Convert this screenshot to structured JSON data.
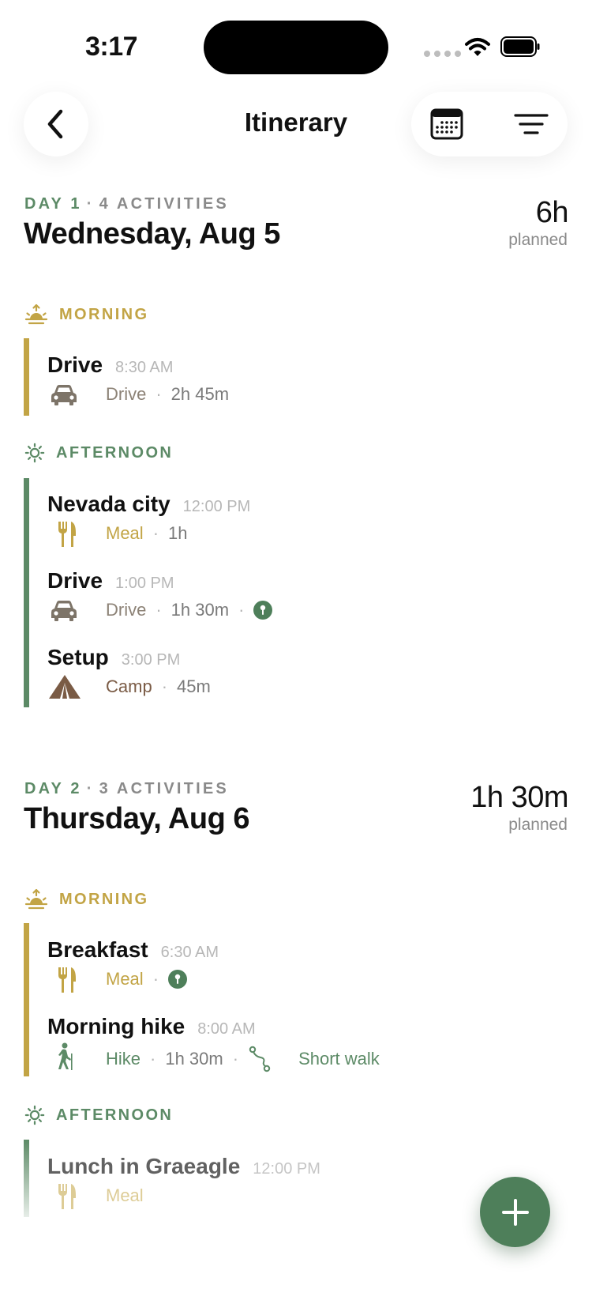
{
  "status": {
    "time": "3:17"
  },
  "header": {
    "title": "Itinerary"
  },
  "colors": {
    "morning": "#c2a445",
    "afternoon": "#5c8a66",
    "fab": "#4e7f5a"
  },
  "days": [
    {
      "day_label": "DAY 1",
      "count_label": "4 ACTIVITIES",
      "title": "Wednesday, Aug 5",
      "total": "6h",
      "total_label": "planned",
      "periods": [
        {
          "label": "MORNING",
          "icon": "sunrise-icon",
          "activities": [
            {
              "name": "Drive",
              "time": "8:30 AM",
              "icon": "car-icon",
              "category": "Drive",
              "duration": "2h 45m"
            }
          ]
        },
        {
          "label": "AFTERNOON",
          "icon": "sun-icon",
          "activities": [
            {
              "name": "Nevada city",
              "time": "12:00 PM",
              "icon": "fork-knife-icon",
              "category": "Meal",
              "duration": "1h"
            },
            {
              "name": "Drive",
              "time": "1:00 PM",
              "icon": "car-icon",
              "category": "Drive",
              "duration": "1h 30m",
              "has_location": true
            },
            {
              "name": "Setup",
              "time": "3:00 PM",
              "icon": "tent-icon",
              "category": "Camp",
              "duration": "45m"
            }
          ]
        }
      ]
    },
    {
      "day_label": "DAY 2",
      "count_label": "3 ACTIVITIES",
      "title": "Thursday, Aug 6",
      "total": "1h 30m",
      "total_label": "planned",
      "periods": [
        {
          "label": "MORNING",
          "icon": "sunrise-icon",
          "activities": [
            {
              "name": "Breakfast",
              "time": "6:30 AM",
              "icon": "fork-knife-icon",
              "category": "Meal",
              "has_location": true
            },
            {
              "name": "Morning hike",
              "time": "8:00 AM",
              "icon": "hiker-icon",
              "category": "Hike",
              "duration": "1h 30m",
              "trail_label": "Short walk"
            }
          ]
        },
        {
          "label": "AFTERNOON",
          "icon": "sun-icon",
          "activities": [
            {
              "name": "Lunch in Graeagle",
              "time": "12:00 PM",
              "icon": "fork-knife-icon",
              "category": "Meal"
            }
          ]
        }
      ]
    }
  ]
}
